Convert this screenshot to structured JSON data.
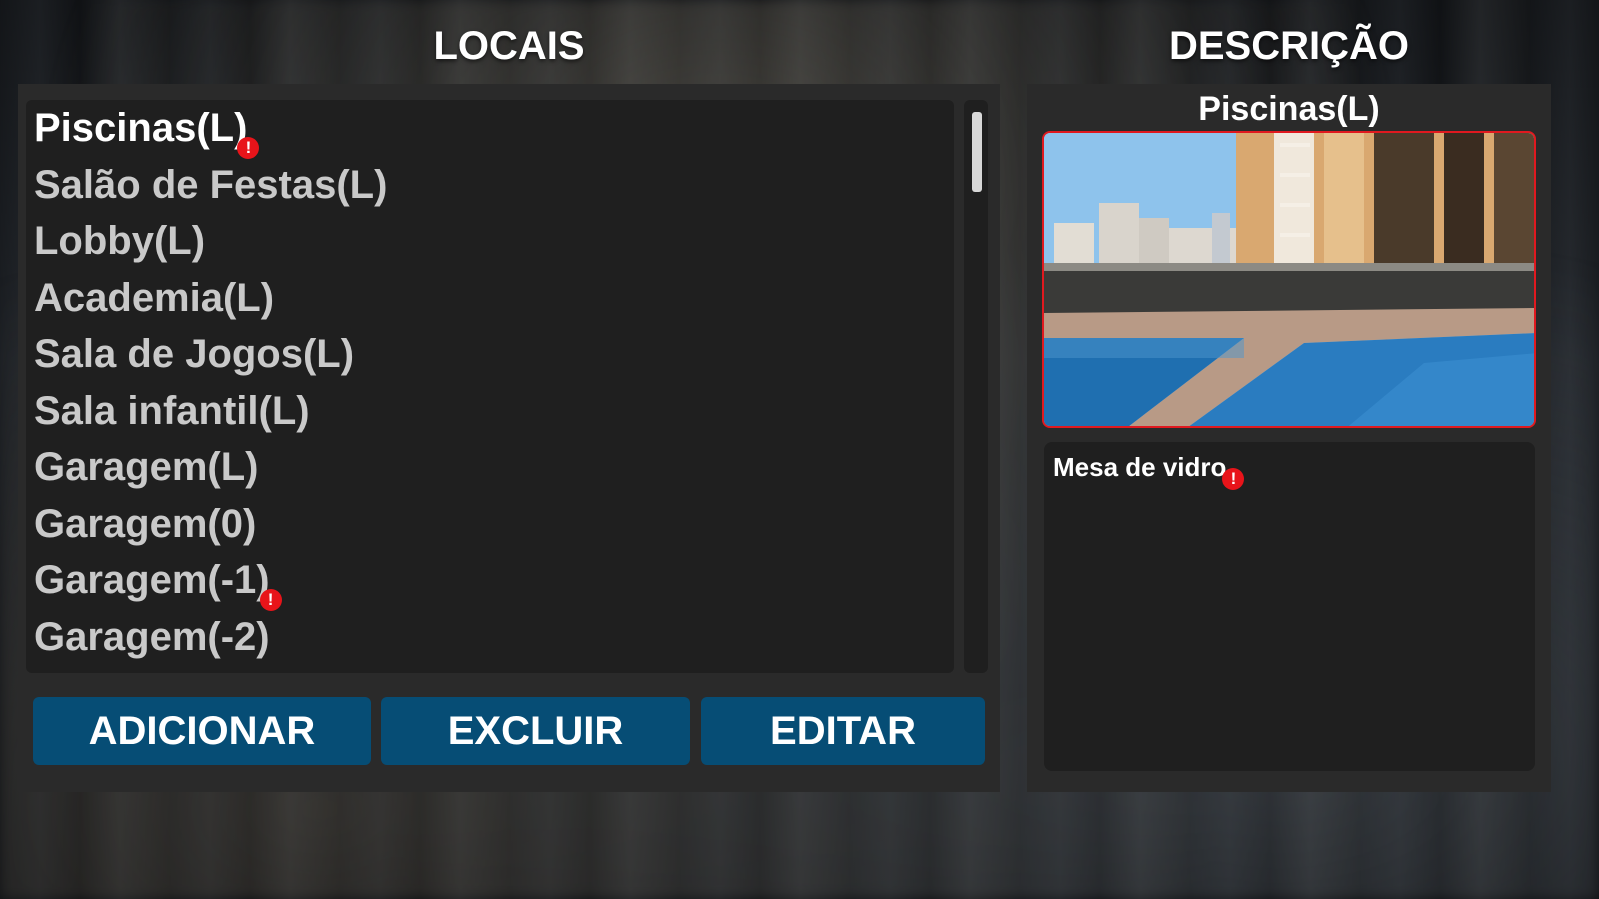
{
  "locais": {
    "title": "LOCAIS",
    "items": [
      {
        "label": "Piscinas(L)",
        "selected": true,
        "warning": true
      },
      {
        "label": "Salão de Festas(L)",
        "selected": false,
        "warning": false
      },
      {
        "label": "Lobby(L)",
        "selected": false,
        "warning": false
      },
      {
        "label": "Academia(L)",
        "selected": false,
        "warning": false
      },
      {
        "label": "Sala de Jogos(L)",
        "selected": false,
        "warning": false
      },
      {
        "label": "Sala infantil(L)",
        "selected": false,
        "warning": false
      },
      {
        "label": "Garagem(L)",
        "selected": false,
        "warning": false
      },
      {
        "label": "Garagem(0)",
        "selected": false,
        "warning": false
      },
      {
        "label": "Garagem(-1)",
        "selected": false,
        "warning": true
      },
      {
        "label": "Garagem(-2)",
        "selected": false,
        "warning": false
      }
    ],
    "buttons": {
      "add": "ADICIONAR",
      "delete": "EXCLUIR",
      "edit": "EDITAR"
    }
  },
  "descricao": {
    "title": "DESCRIÇÃO",
    "selected_name": "Piscinas(L)",
    "photo_icon": "pool-photo",
    "text": "Mesa de vidro",
    "text_warning": true
  },
  "colors": {
    "button": "#064d75",
    "panel": "#2a2a2a",
    "list_bg": "#1f1f1f",
    "warning": "#e8141a",
    "photo_border": "#e0191f"
  },
  "warning_glyph": "!"
}
